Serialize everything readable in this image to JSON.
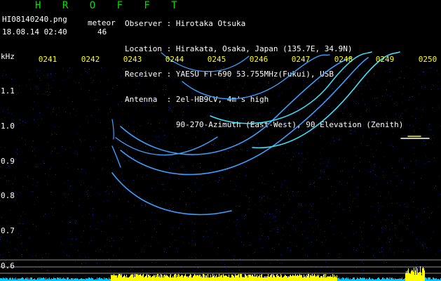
{
  "app": {
    "title": "H R O F F T",
    "filename": "HI08140240.png",
    "mode": "meteor",
    "datetime": "18.08.14 02:40",
    "count": "46"
  },
  "meta": {
    "observer": "Observer : Hirotaka Otsuka",
    "location": "Location : Hirakata, Osaka, Japan (135.7E, 34.9N)",
    "receiver": "Receiver : YAESU FT-690 53.755MHz(Fukui), USB",
    "antenna": "Antenna  : 2el-HB9CV, 4m's high",
    "antenna2": "           90-270-Azimuth (East-West), 90-Elevation (Zenith)"
  },
  "axis": {
    "freq_unit": "kHz",
    "time_labels": [
      "0241",
      "0242",
      "0243",
      "0244",
      "0245",
      "0246",
      "0247",
      "0248",
      "0249",
      "0250"
    ],
    "freq_labels": [
      "1.1",
      "1.0",
      "0.9",
      "0.8",
      "0.7",
      "0.6"
    ]
  },
  "colors": {
    "background": "#000000",
    "title_green": "#00e000",
    "time_label_yellow": "#ffff00",
    "trace_blue": "#3aa0ff",
    "trace_cyan": "#40e0ff",
    "noise_bar_cyan": "#00c8ff",
    "noise_bar_yellow": "#ffff00"
  }
}
